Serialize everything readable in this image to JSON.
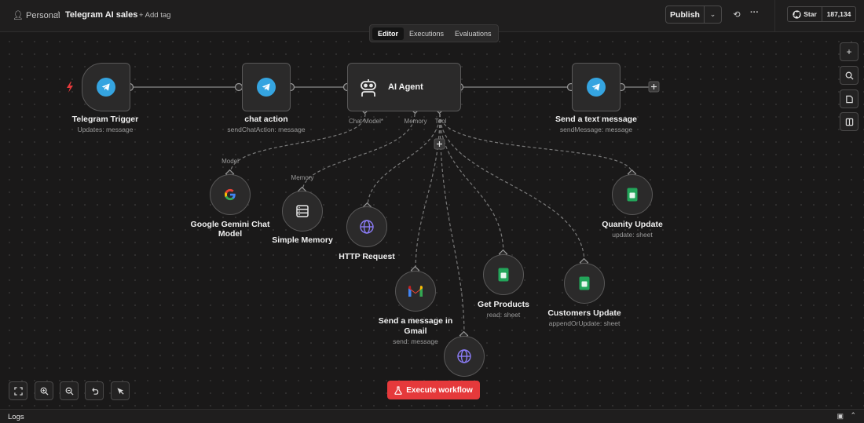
{
  "header": {
    "personal": "Personal",
    "separator": "/",
    "workflow_title": "Telegram AI sales",
    "add_tag": "+ Add tag",
    "publish_label": "Publish",
    "github_star": "Star",
    "github_count": "187,134"
  },
  "tabs": [
    {
      "label": "Editor",
      "active": true
    },
    {
      "label": "Executions",
      "active": false
    },
    {
      "label": "Evaluations",
      "active": false
    }
  ],
  "nodes": {
    "telegram_trigger": {
      "name": "Telegram Trigger",
      "sub": "Updates: message",
      "icon": "telegram-icon"
    },
    "chat_action": {
      "name": "chat action",
      "sub": "sendChatAction: message",
      "icon": "telegram-icon"
    },
    "ai_agent": {
      "name": "AI Agent",
      "icon": "robot-icon",
      "ports": [
        "Chat Model*",
        "Memory",
        "Tool"
      ]
    },
    "send_text": {
      "name": "Send a text message",
      "sub": "sendMessage: message",
      "icon": "telegram-icon"
    },
    "gemini": {
      "name_line1": "Google Gemini Chat",
      "name_line2": "Model",
      "port": "Model",
      "icon": "google-icon"
    },
    "memory": {
      "name": "Simple Memory",
      "port": "Memory",
      "icon": "database-icon"
    },
    "http": {
      "name": "HTTP Request",
      "icon": "globe-icon"
    },
    "gmail": {
      "name_line1": "Send a message in",
      "name_line2": "Gmail",
      "sub": "send: message",
      "icon": "gmail-icon"
    },
    "get_products": {
      "name": "Get Products",
      "sub": "read: sheet",
      "icon": "sheets-icon"
    },
    "customers_update": {
      "name": "Customers Update",
      "sub": "appendOrUpdate: sheet",
      "icon": "sheets-icon"
    },
    "quanity_update": {
      "name": "Quanity Update",
      "sub": "update: sheet",
      "icon": "sheets-icon"
    },
    "http2": {
      "icon": "globe-icon"
    }
  },
  "execute_label": "Execute workflow",
  "logs_label": "Logs",
  "colors": {
    "accent": "#e5393b",
    "telegram": "#35a4e0",
    "sheets": "#23a55a",
    "globe": "#8b7cf6"
  }
}
